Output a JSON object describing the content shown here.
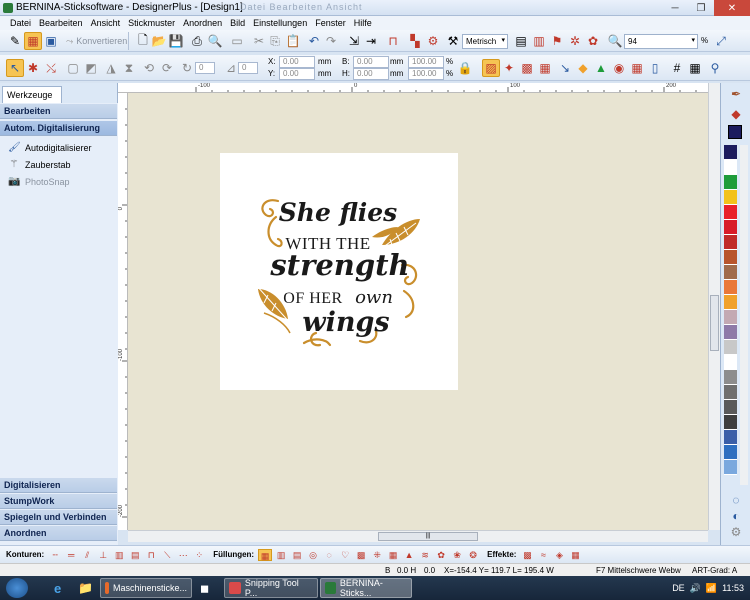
{
  "window": {
    "title": "BERNINA-Sticksoftware - DesignerPlus - [Design1]",
    "faded_menu": "Datei  Bearbeiten  Ansicht"
  },
  "menu": [
    "Datei",
    "Bearbeiten",
    "Ansicht",
    "Stickmuster",
    "Anordnen",
    "Bild",
    "Einstellungen",
    "Fenster",
    "Hilfe"
  ],
  "toolbar1": {
    "convert_label": "Konvertieren",
    "unit": "Metrisch",
    "zoom": "94",
    "zoom_unit": "%"
  },
  "toolbar2": {
    "angle": "0",
    "rotate": "0",
    "x_label": "X:",
    "x_value": "0.00",
    "x_unit": "mm",
    "y_label": "Y:",
    "y_value": "0.00",
    "y_unit": "mm",
    "b_label": "B:",
    "b_value": "0.00",
    "b_unit": "mm",
    "h_label": "H:",
    "h_value": "0.00",
    "h_unit": "mm",
    "scale_w": "100.00",
    "scale_h": "100.00",
    "pct": "%"
  },
  "left_panel": {
    "tab": "Werkzeuge",
    "sections_top": [
      "Bearbeiten",
      "Autom. Digitalisierung"
    ],
    "items": [
      {
        "label": "Autodigitalisierer",
        "icon": "brush-icon"
      },
      {
        "label": "Zauberstab",
        "icon": "magic-wand-icon"
      },
      {
        "label": "PhotoSnap",
        "icon": "camera-icon"
      }
    ],
    "sections_bottom": [
      "Digitalisieren",
      "StumpWork",
      "Spiegeln und Verbinden",
      "Anordnen"
    ]
  },
  "rulers": {
    "top": [
      "-100",
      "0",
      "100",
      "200"
    ],
    "left": [
      "0",
      "-100",
      "-200"
    ]
  },
  "design_text": {
    "line1": "She flies",
    "line2": "WITH THE",
    "line3": "strength",
    "line4a": "OF HER",
    "line4b": "own",
    "line5": "wings"
  },
  "colors": {
    "gold": "#c98e2c",
    "ink": "#1a1a1a",
    "canvas": "#e8e4d2",
    "palette": [
      "#1b1b5e",
      "#ffffff",
      "#1e9c3a",
      "#f2c21b",
      "#e8202a",
      "#d81b2a",
      "#c02a2a",
      "#b8552e",
      "#a06b4d",
      "#e9783a",
      "#f0a12c",
      "#c3a9b3",
      "#8e7aa8",
      "#c8c8c8",
      "#ffffff",
      "#8d8d8d",
      "#6f6f6f",
      "#5a5a5a",
      "#3e3e3e",
      "#3a5fa8",
      "#2e6fc0",
      "#7aa8de",
      "#9bc3e8",
      "#6bb8c8",
      "#3a9a9a",
      "#7bc3b2"
    ]
  },
  "bottom_toolbar": {
    "konturen": "Konturen:",
    "fuellungen": "Füllungen:",
    "effekte": "Effekte:"
  },
  "status": {
    "b": "B",
    "stitches": "0.0 H",
    "h": "0.0",
    "coords": "X=-154.4 Y= 119.7 L= 195.4 W",
    "fabric": "F7 Mittelschwere Webw",
    "art": "ART-Grad: A"
  },
  "taskbar": {
    "items": [
      "Maschinensticke...",
      "Snipping Tool P...",
      "BERNINA-Sticks..."
    ],
    "time": "11:53",
    "lang": "DE"
  }
}
